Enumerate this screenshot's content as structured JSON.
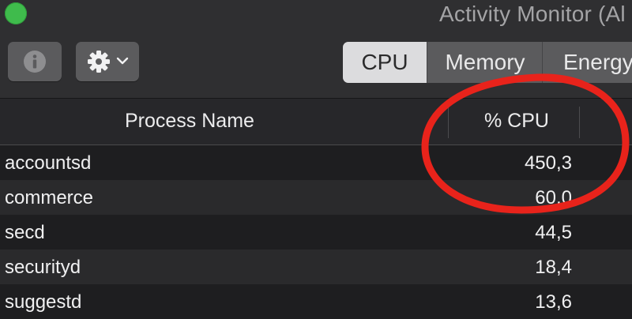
{
  "window": {
    "title": "Activity Monitor (Al"
  },
  "toolbar": {
    "info_icon": "info-icon",
    "gear_icon": "gear-icon",
    "chevron_icon": "chevron-down-icon",
    "tabs": [
      {
        "label": "CPU",
        "selected": true
      },
      {
        "label": "Memory",
        "selected": false
      },
      {
        "label": "Energy",
        "selected": false
      }
    ]
  },
  "table": {
    "columns": [
      "Process Name",
      "% CPU"
    ],
    "rows": [
      {
        "name": "accountsd",
        "cpu": "450,3"
      },
      {
        "name": "commerce",
        "cpu": "60,0"
      },
      {
        "name": "secd",
        "cpu": "44,5"
      },
      {
        "name": "securityd",
        "cpu": "18,4"
      },
      {
        "name": "suggestd",
        "cpu": "13,6"
      }
    ]
  },
  "colors": {
    "traffic_light_green": "#3fbb4c",
    "selected_tab": "#dcdcde",
    "highlight_red": "#e8231b"
  }
}
